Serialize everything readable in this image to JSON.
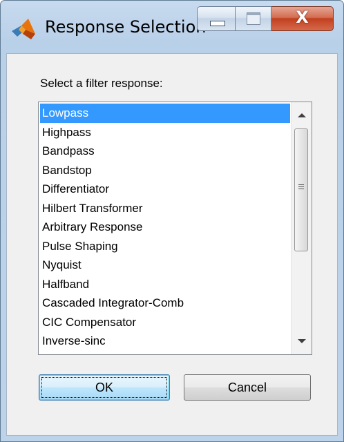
{
  "window": {
    "title": "Response Selection",
    "close_glyph": "X",
    "icon": "matlab-logo-icon"
  },
  "dialog": {
    "prompt": "Select a filter response:",
    "responses": [
      "Lowpass",
      "Highpass",
      "Bandpass",
      "Bandstop",
      "Differentiator",
      "Hilbert Transformer",
      "Arbitrary Response",
      "Pulse Shaping",
      "Nyquist",
      "Halfband",
      "Cascaded Integrator-Comb",
      "CIC Compensator",
      "Inverse-sinc"
    ],
    "selected": "Lowpass",
    "ok_label": "OK",
    "cancel_label": "Cancel"
  },
  "colors": {
    "selection": "#3399ff",
    "close_button": "#c1401e",
    "dialog_background": "#f0f0f0"
  }
}
